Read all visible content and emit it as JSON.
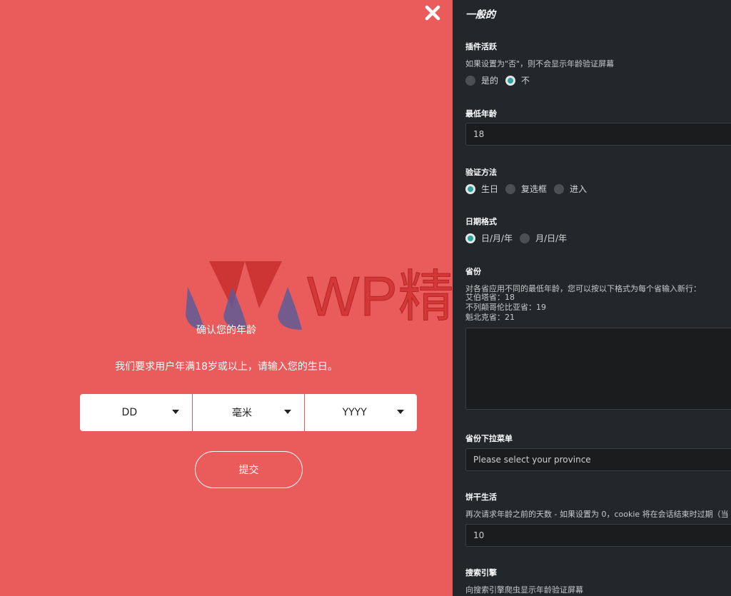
{
  "preview": {
    "close_icon": "close-icon",
    "watermark_text": "WP精品站",
    "title": "确认您的年龄",
    "description": "我们要求用户年满18岁或以上，请输入您的生日。",
    "date_selects": [
      {
        "value": "DD"
      },
      {
        "value": "毫米"
      },
      {
        "value": "YYYY"
      }
    ],
    "submit_label": "提交",
    "colors": {
      "background": "#ea5c5c",
      "text": "#ffffff"
    }
  },
  "panel": {
    "heading": "一般的",
    "plugin_active": {
      "label": "插件活跃",
      "desc": "如果设置为\"否\"，则不会显示年龄验证屏幕",
      "options": [
        "是的",
        "不"
      ],
      "selected": "不"
    },
    "min_age": {
      "label": "最低年龄",
      "value": "18"
    },
    "verify_method": {
      "label": "验证方法",
      "options": [
        "生日",
        "复选框",
        "进入"
      ],
      "selected": "生日"
    },
    "date_format": {
      "label": "日期格式",
      "options": [
        "日/月/年",
        "月/日/年"
      ],
      "selected": "日/月/年"
    },
    "province": {
      "label": "省份",
      "desc": "对各省应用不同的最低年龄，您可以按以下格式为每个省输入新行：",
      "examples": [
        "艾伯塔省：18",
        "不列颠哥伦比亚省：19",
        "魁北克省：21"
      ]
    },
    "province_dropdown": {
      "label": "省份下拉菜单",
      "value": "Please select your province"
    },
    "cookie": {
      "label": "饼干生活",
      "desc": "再次请求年龄之前的天数 - 如果设置为 0，cookie 将在会话结束时过期（当",
      "value": "10"
    },
    "search_engine": {
      "label": "搜索引擎",
      "desc": "向搜索引擎爬虫显示年龄验证屏幕"
    },
    "colors": {
      "background": "#23272a",
      "accent": "#2aa6a0"
    }
  }
}
